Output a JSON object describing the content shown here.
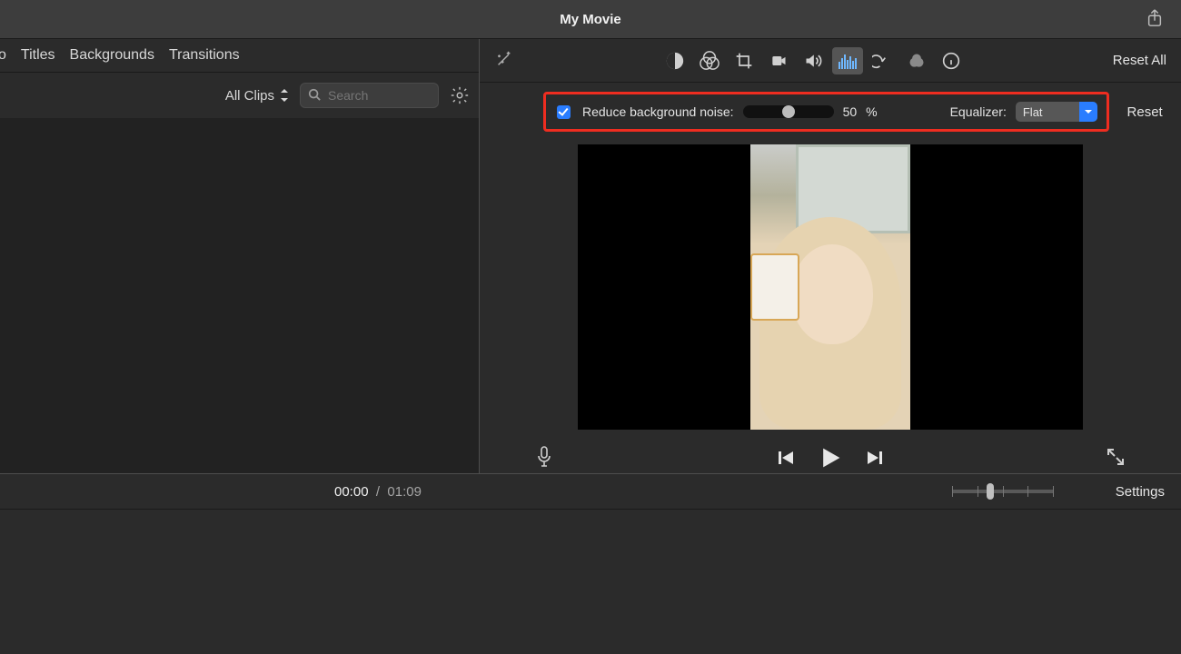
{
  "titlebar": {
    "title": "My Movie"
  },
  "browser": {
    "tabs": [
      "o",
      "Titles",
      "Backgrounds",
      "Transitions"
    ],
    "clips_filter": "All Clips",
    "search_placeholder": "Search"
  },
  "inspector": {
    "reset_all": "Reset All",
    "reduce_noise_label": "Reduce background noise:",
    "noise_value": "50",
    "noise_unit": "%",
    "equalizer_label": "Equalizer:",
    "equalizer_value": "Flat",
    "reset": "Reset"
  },
  "transport": {
    "time_current": "00:00",
    "time_separator": "/",
    "time_total": "01:09",
    "settings": "Settings"
  }
}
